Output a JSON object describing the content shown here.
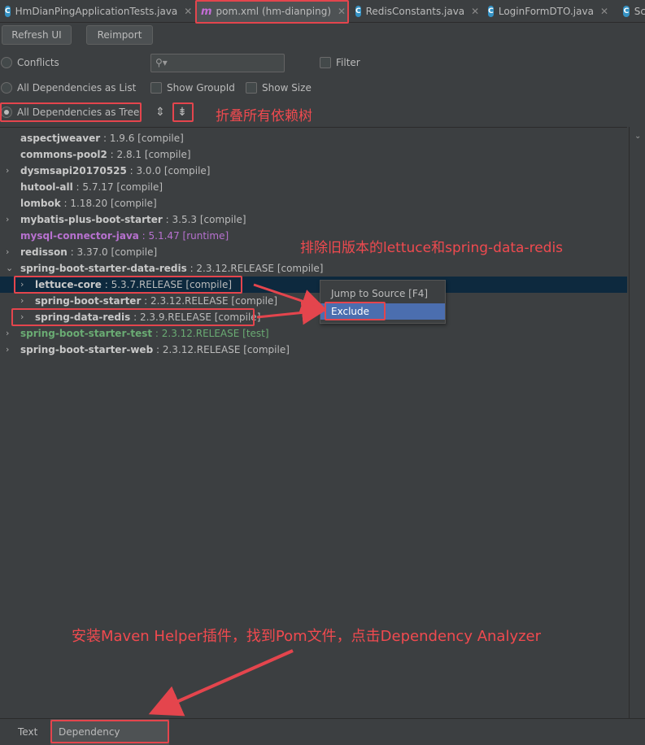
{
  "tabs": [
    {
      "label": "HmDianPingApplicationTests.java",
      "icon": "test-class-icon"
    },
    {
      "label": "pom.xml (hm-dianping)",
      "icon": "maven-icon"
    },
    {
      "label": "RedisConstants.java",
      "icon": "class-icon"
    },
    {
      "label": "LoginFormDTO.java",
      "icon": "class-icon"
    },
    {
      "label": "Sc",
      "icon": "class-icon"
    }
  ],
  "toolbar": {
    "refresh_label": "Refresh UI",
    "reimport_label": "Reimport"
  },
  "options": {
    "conflicts": "Conflicts",
    "list": "All Dependencies as List",
    "tree": "All Dependencies as Tree",
    "filter": "Filter",
    "show_groupid": "Show GroupId",
    "show_size": "Show Size",
    "search_placeholder": ""
  },
  "tree": [
    {
      "name": "aspectjweaver",
      "ver": " : 1.9.6 [compile]",
      "expandable": false,
      "indent": 0
    },
    {
      "name": "commons-pool2",
      "ver": " : 2.8.1 [compile]",
      "expandable": false,
      "indent": 0
    },
    {
      "name": "dysmsapi20170525",
      "ver": " : 3.0.0 [compile]",
      "expandable": true,
      "indent": 0
    },
    {
      "name": "hutool-all",
      "ver": " : 5.7.17 [compile]",
      "expandable": false,
      "indent": 0
    },
    {
      "name": "lombok",
      "ver": " : 1.18.20 [compile]",
      "expandable": false,
      "indent": 0
    },
    {
      "name": "mybatis-plus-boot-starter",
      "ver": " : 3.5.3 [compile]",
      "expandable": true,
      "indent": 0
    },
    {
      "name": "mysql-connector-java",
      "ver": " : 5.1.47 [runtime]",
      "expandable": false,
      "indent": 0,
      "scope": "runtime"
    },
    {
      "name": "redisson",
      "ver": " : 3.37.0 [compile]",
      "expandable": true,
      "indent": 0
    },
    {
      "name": "spring-boot-starter-data-redis",
      "ver": " : 2.3.12.RELEASE [compile]",
      "expandable": true,
      "expanded": true,
      "indent": 0
    },
    {
      "name": "lettuce-core",
      "ver": " : 5.3.7.RELEASE [compile]",
      "expandable": true,
      "indent": 1,
      "selected": true
    },
    {
      "name": "spring-boot-starter",
      "ver": " : 2.3.12.RELEASE [compile]",
      "expandable": true,
      "indent": 1
    },
    {
      "name": "spring-data-redis",
      "ver": " : 2.3.9.RELEASE [compile]",
      "expandable": true,
      "indent": 1
    },
    {
      "name": "spring-boot-starter-test",
      "ver": " : 2.3.12.RELEASE [test]",
      "expandable": true,
      "indent": 0,
      "scope": "test"
    },
    {
      "name": "spring-boot-starter-web",
      "ver": " : 2.3.12.RELEASE [compile]",
      "expandable": true,
      "indent": 0
    }
  ],
  "context_menu": {
    "jump": "Jump to Source [F4]",
    "exclude": "Exclude"
  },
  "annotations": {
    "collapse": "折叠所有依赖树",
    "exclude": "排除旧版本的lettuce和spring-data-redis",
    "install": "安装Maven Helper插件，找到Pom文件，点击Dependency Analyzer"
  },
  "bottom_tabs": {
    "text": "Text",
    "analyzer": "Dependency Analyzer"
  },
  "colors": {
    "annotation": "#f04a4f",
    "selection": "#0d293e",
    "runtime": "#b771cf",
    "test": "#6aab73"
  }
}
